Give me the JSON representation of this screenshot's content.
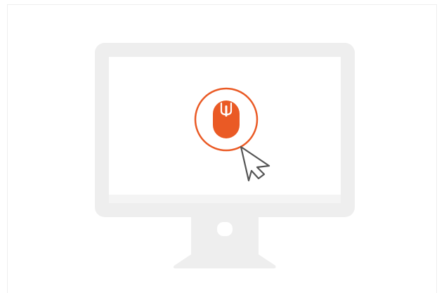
{
  "illustration": {
    "subject": "monitor-with-mouse-click",
    "icons": [
      "monitor-icon",
      "mouse-icon",
      "cursor-arrow-icon"
    ],
    "colors": {
      "background": "#ffffff",
      "frame_border": "#eeeeee",
      "monitor_body": "#eeeeee",
      "screen": "#ffffff",
      "screen_bottom_strip": "#f4f4f4",
      "accent": "#ea5a25",
      "ring_fill": "#ffffff",
      "mouse_detail": "#ffffff",
      "cursor_fill": "#ffffff",
      "cursor_stroke": "#555555"
    }
  }
}
